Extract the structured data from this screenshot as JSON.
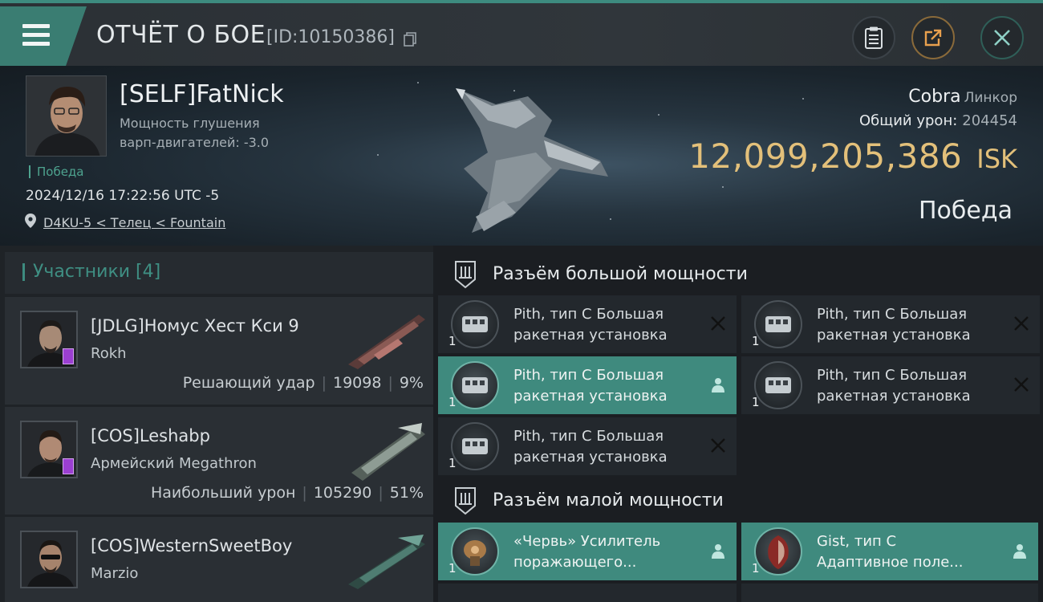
{
  "header": {
    "title": "ОТЧЁТ О БОЕ",
    "report_id": "[ID:10150386]",
    "icons": [
      "menu-icon",
      "copy-icon",
      "report-icon",
      "share-icon",
      "close-icon"
    ]
  },
  "hero": {
    "pilot_name": "[SELF]FatNick",
    "stat_line1": "Мощность глушения",
    "stat_line2": "варп-двигателей: -3.0",
    "result_tag": "Победа",
    "datetime": "2024/12/16 17:22:56 UTC -5",
    "location": "D4KU-5 < Телец < Fountain",
    "ship_name": "Cobra",
    "ship_class": "Линкор",
    "damage_label": "Общий урон:",
    "damage_value": "204454",
    "isk_value": "12,099,205,386",
    "isk_unit": "ISK",
    "outcome": "Победа"
  },
  "participants": {
    "title": "Участники [4]",
    "rows": [
      {
        "name": "[JDLG]Номус Хест Кси 9",
        "ship": "Rokh",
        "role": "Решающий удар",
        "damage": "19098",
        "percent": "9%"
      },
      {
        "name": "[COS]Leshabp",
        "ship": "Армейский Megathron",
        "role": "Наибольший урон",
        "damage": "105290",
        "percent": "51%"
      },
      {
        "name": "[COS]WesternSweetBoy",
        "ship": "Marzio",
        "role": "",
        "damage": "",
        "percent": ""
      }
    ]
  },
  "modules": {
    "high_slot_title": "Разъём большой мощности",
    "low_slot_title": "Разъём малой мощности",
    "high": [
      {
        "qty": "1",
        "line1": "Pith, тип C Большая",
        "line2": "ракетная установка",
        "status": "destroyed"
      },
      {
        "qty": "1",
        "line1": "Pith, тип C Большая",
        "line2": "ракетная установка",
        "status": "destroyed"
      },
      {
        "qty": "1",
        "line1": "Pith, тип C Большая",
        "line2": "ракетная установка",
        "status": "dropped"
      },
      {
        "qty": "1",
        "line1": "Pith, тип C Большая",
        "line2": "ракетная установка",
        "status": "destroyed"
      },
      {
        "qty": "1",
        "line1": "Pith, тип C Большая",
        "line2": "ракетная установка",
        "status": "destroyed"
      }
    ],
    "low": [
      {
        "qty": "1",
        "line1": "«Червь» Усилитель",
        "line2": "поражающего...",
        "status": "dropped"
      },
      {
        "qty": "1",
        "line1": "Gist, тип C",
        "line2": "Адаптивное поле...",
        "status": "dropped"
      }
    ]
  },
  "colors": {
    "accent": "#3d8b7f",
    "isk": "#e3c07a",
    "active_module": "#3f8a7e"
  }
}
